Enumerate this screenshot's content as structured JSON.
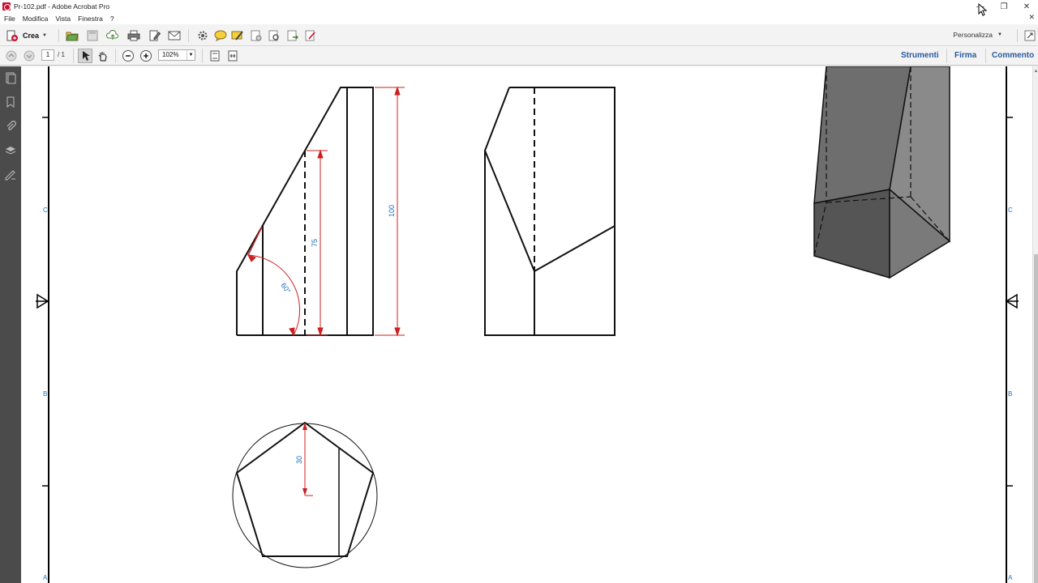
{
  "window": {
    "title": "Pr-102.pdf - Adobe Acrobat Pro",
    "minimize_glyph": "—",
    "restore_glyph": "❐",
    "close_glyph": "✕"
  },
  "menu": {
    "items": [
      "File",
      "Modifica",
      "Vista",
      "Finestra",
      "?"
    ],
    "doc_close": "✕"
  },
  "toolbar": {
    "crea_label": "Crea",
    "personalizza_label": "Personalizza",
    "icons": [
      "open-folder-icon",
      "save-icon",
      "cloud-icon",
      "print-icon",
      "edit-icon",
      "email-icon",
      "gear-icon",
      "comment-icon",
      "highlight-icon",
      "stamp-icon",
      "compare-icon",
      "export-icon",
      "sign-icon"
    ]
  },
  "navigation": {
    "page_current": "1",
    "page_total": "/ 1",
    "zoom": "102%",
    "right_links": [
      "Strumenti",
      "Firma",
      "Commento"
    ]
  },
  "drawing": {
    "dim_height_total": "100",
    "dim_height_cut": "75",
    "dim_angle": "60°",
    "dim_radius": "30",
    "margin_left_labels": [
      "C",
      "B",
      "A"
    ],
    "margin_right_labels": [
      "C",
      "B",
      "A"
    ],
    "colors": {
      "dimension": "#cc1f1f",
      "dimension_text": "#1f6fb8",
      "line": "#111111",
      "solid_dark": "#555555",
      "solid_mid": "#6e6e6e",
      "solid_light": "#8a8a8a"
    }
  }
}
